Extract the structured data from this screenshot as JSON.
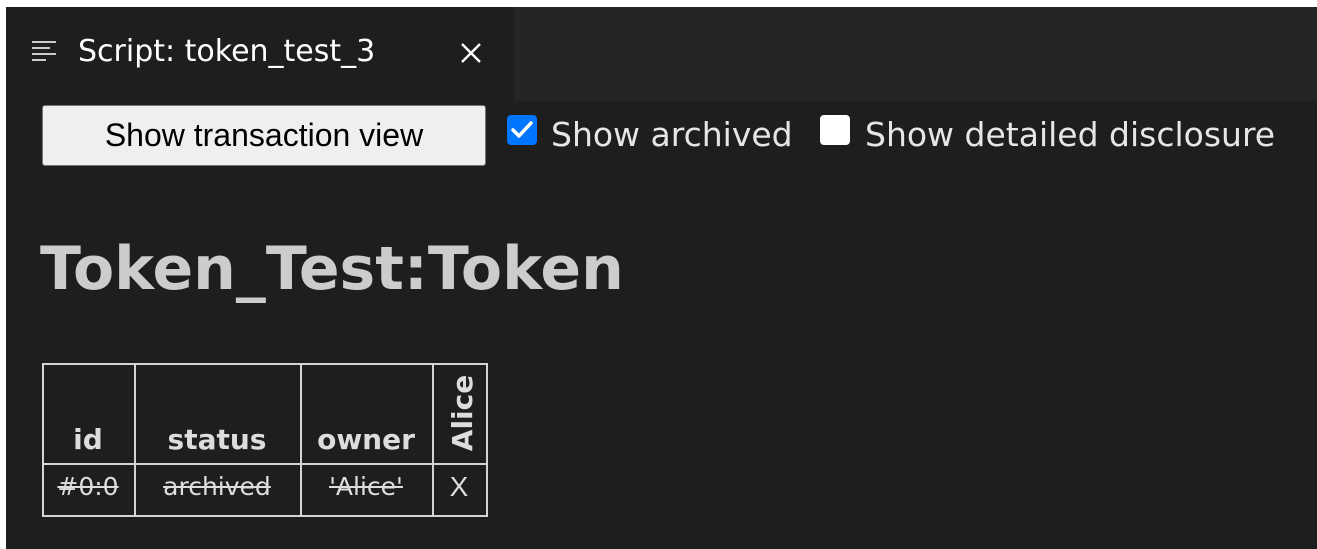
{
  "tab": {
    "title": "Script: token_test_3",
    "icon": "list-icon",
    "close_icon": "close-icon"
  },
  "toolbar": {
    "transaction_button_label": "Show transaction view",
    "show_archived_label": "Show archived",
    "show_archived_checked": true,
    "show_detailed_label": "Show detailed disclosure",
    "show_detailed_checked": false
  },
  "page": {
    "title": "Token_Test:Token"
  },
  "table": {
    "headers": [
      "id",
      "status",
      "owner",
      "Alice"
    ],
    "rows": [
      {
        "id": "#0:0",
        "status": "archived",
        "owner": "'Alice'",
        "alice": "X",
        "archived": true
      }
    ]
  },
  "colors": {
    "background": "#1e1e1e",
    "tabbar": "#252526",
    "checkbox_accent": "#0075ff",
    "text": "#dddddd"
  }
}
